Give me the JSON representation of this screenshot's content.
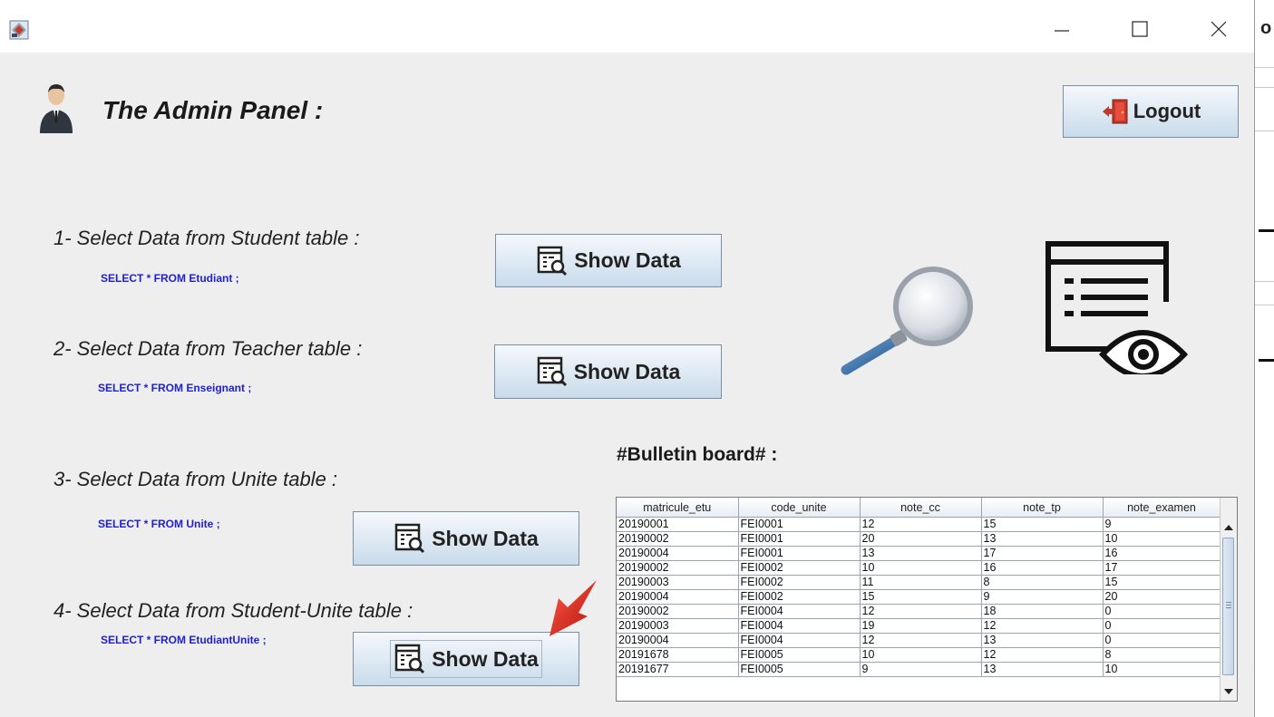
{
  "window": {
    "minimize_icon": "minimize-icon",
    "maximize_icon": "maximize-icon",
    "close_icon": "close-icon",
    "edge_char": "o"
  },
  "header": {
    "title": "The Admin Panel  :",
    "logout_label": "Logout"
  },
  "sections": [
    {
      "label": "1- Select Data from Student table :",
      "sql": "SELECT *  FROM  Etudiant ;",
      "button_label": "Show Data"
    },
    {
      "label": "2- Select Data from Teacher table :",
      "sql": "SELECT * FROM Enseignant ;",
      "button_label": "Show Data"
    },
    {
      "label": "3- Select Data from Unite table :",
      "sql": "SELECT * FROM Unite ;",
      "button_label": "Show Data"
    },
    {
      "label": "4- Select Data from Student-Unite table :",
      "sql": "SELECT * FROM EtudiantUnite ;",
      "button_label": "Show Data"
    }
  ],
  "bulletin": {
    "title": "#Bulletin board# :",
    "columns": [
      "matricule_etu",
      "code_unite",
      "note_cc",
      "note_tp",
      "note_examen"
    ],
    "rows": [
      [
        "20190001",
        "FEI0001",
        "12",
        "15",
        "9"
      ],
      [
        "20190002",
        "FEI0001",
        "20",
        "13",
        "10"
      ],
      [
        "20190004",
        "FEI0001",
        "13",
        "17",
        "16"
      ],
      [
        "20190002",
        "FEI0002",
        "10",
        "16",
        "17"
      ],
      [
        "20190003",
        "FEI0002",
        "11",
        "8",
        "15"
      ],
      [
        "20190004",
        "FEI0002",
        "15",
        "9",
        "20"
      ],
      [
        "20190002",
        "FEI0004",
        "12",
        "18",
        "0"
      ],
      [
        "20190003",
        "FEI0004",
        "19",
        "12",
        "0"
      ],
      [
        "20190004",
        "FEI0004",
        "12",
        "13",
        "0"
      ],
      [
        "20191678",
        "FEI0005",
        "10",
        "12",
        "8"
      ],
      [
        "20191677",
        "FEI0005",
        "9",
        "13",
        "10"
      ]
    ]
  },
  "colors": {
    "sql_text": "#1f1fd0",
    "panel_bg": "#eeeeee",
    "arrow_red": "#e0201b"
  }
}
